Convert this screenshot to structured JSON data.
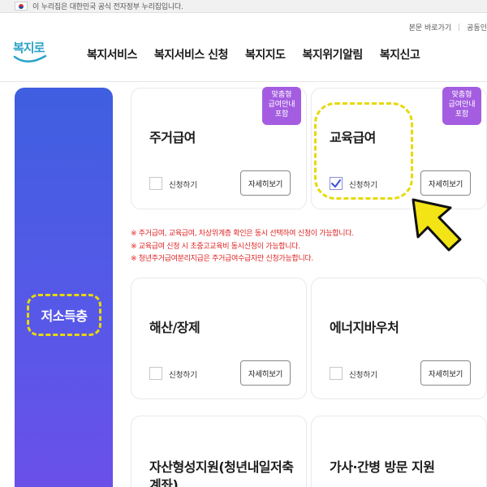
{
  "gov_banner": {
    "text": "이 누리집은 대한민국 공식 전자정부 누리집입니다."
  },
  "util_links": [
    "본문 바로가기",
    "공동인"
  ],
  "logo": {
    "text": "복지로"
  },
  "gnb": [
    "복지서비스",
    "복지서비스 신청",
    "복지지도",
    "복지위기알림",
    "복지신고"
  ],
  "side_category": {
    "label": "저소득층"
  },
  "cards": [
    {
      "title": "주거급여",
      "badge": [
        "맞춤형",
        "급여안내",
        "포함"
      ],
      "check_label": "신청하기",
      "checked": false,
      "detail_label": "자세히보기"
    },
    {
      "title": "교육급여",
      "badge": [
        "맞춤형",
        "급여안내",
        "포함"
      ],
      "check_label": "신청하기",
      "checked": true,
      "detail_label": "자세히보기"
    },
    {
      "title": "해산/장제",
      "check_label": "신청하기",
      "checked": false,
      "detail_label": "자세히보기"
    },
    {
      "title": "에너지바우처",
      "check_label": "신청하기",
      "checked": false,
      "detail_label": "자세히보기"
    },
    {
      "title": "자산형성지원(청년내일저축계좌)"
    },
    {
      "title": "가사·간병 방문 지원"
    }
  ],
  "notices": [
    "※ 주거급여, 교육급여, 차상위계층 확인은 동시 선택하여 신청이 가능합니다.",
    "※ 교육급여 신청 시 초중고교육비 동시신청이 가능합니다.",
    "※ 청년주거급여분리지급은 주거급여수급자만 신청가능합니다."
  ],
  "colors": {
    "brand": "#2aa3c8",
    "panel": "#4f5ce6",
    "badge": "#a45de0",
    "notice": "#e02222",
    "highlight": "#e8d90a"
  }
}
